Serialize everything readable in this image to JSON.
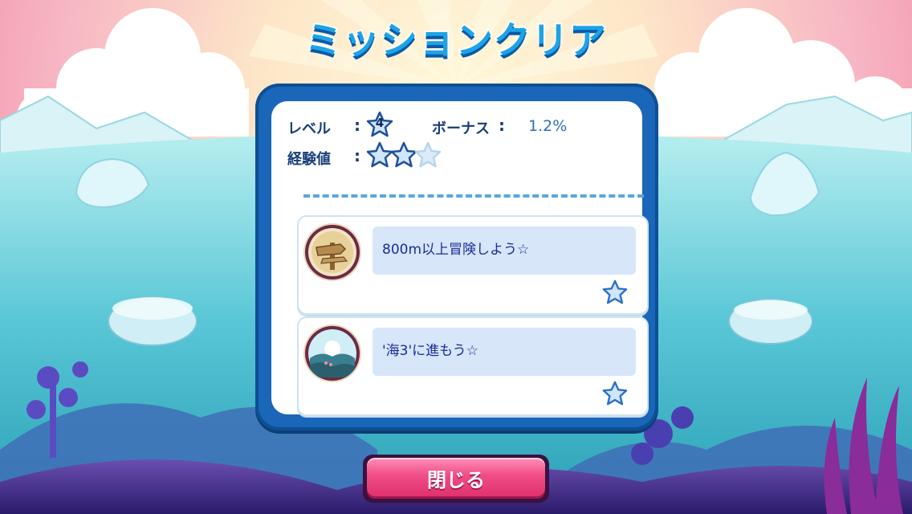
{
  "title": "ミッションクリア",
  "stats": {
    "level_label": "レベル",
    "level_value": "4",
    "bonus_label": "ボーナス",
    "bonus_value": "1.2%",
    "exp_label": "経験値",
    "colon": ":",
    "exp_stars_filled": 2,
    "exp_stars_total": 3
  },
  "missions": [
    {
      "text": "800m以上冒険しよう☆",
      "icon": "signpost-icon",
      "reward_icon": "star-icon"
    },
    {
      "text": "'海3'に進もう☆",
      "icon": "sea-landscape-icon",
      "reward_icon": "star-icon"
    }
  ],
  "close_button": {
    "label": "閉じる"
  },
  "colors": {
    "title": "#1ea3e6",
    "panel_frame": "#1a66b8",
    "button": "#f04d86",
    "text": "#173d7a"
  }
}
